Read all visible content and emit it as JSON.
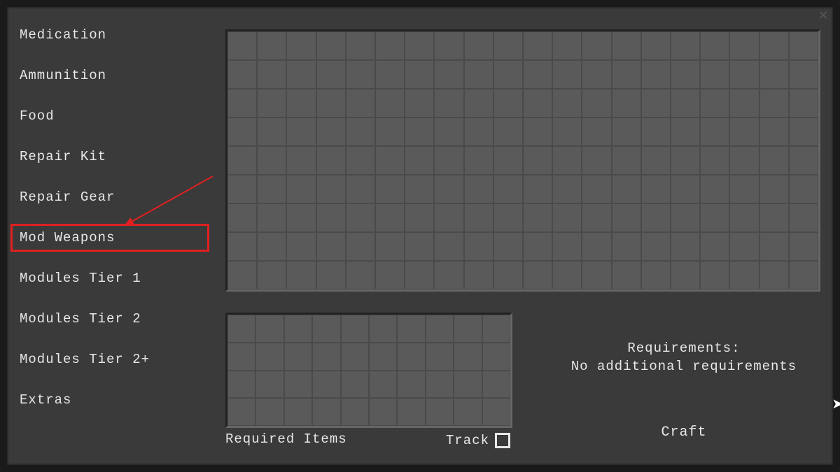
{
  "sidebar": {
    "items": [
      {
        "label": "Medication"
      },
      {
        "label": "Ammunition"
      },
      {
        "label": "Food"
      },
      {
        "label": "Repair Kit"
      },
      {
        "label": "Repair Gear"
      },
      {
        "label": "Mod Weapons"
      },
      {
        "label": "Modules Tier 1"
      },
      {
        "label": "Modules Tier 2"
      },
      {
        "label": "Modules Tier 2+"
      },
      {
        "label": "Extras"
      }
    ],
    "highlighted_index": 5
  },
  "required_items_label": "Required Items",
  "track_label": "Track",
  "track_checked": false,
  "requirements": {
    "title": "Requirements:",
    "text": "No additional requirements"
  },
  "craft_label": "Craft",
  "main_grid": {
    "cols": 20,
    "rows": 9
  },
  "required_grid": {
    "cols": 10,
    "rows": 4
  }
}
